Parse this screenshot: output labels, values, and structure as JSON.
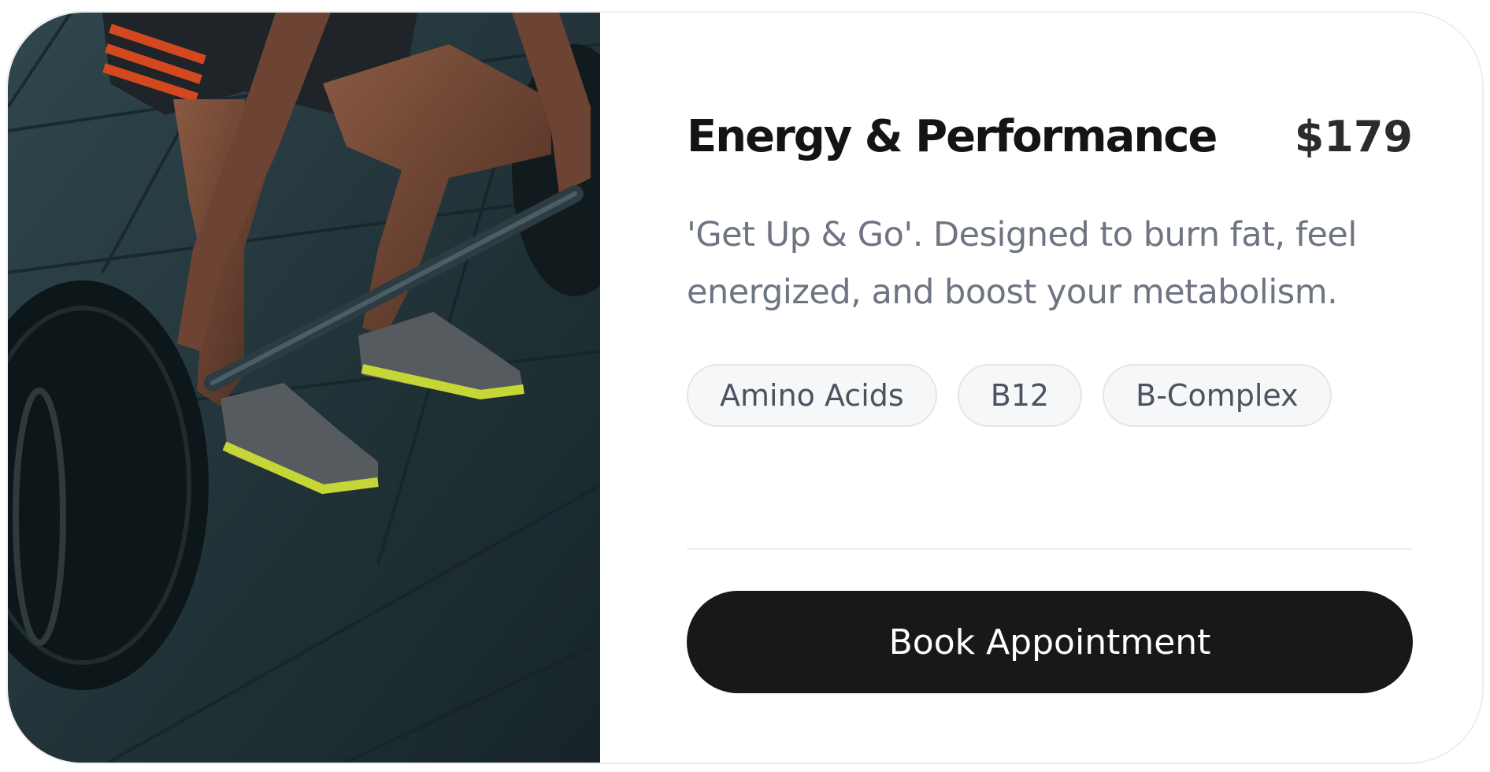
{
  "card": {
    "title": "Energy & Performance",
    "price": "$179",
    "description": "'Get Up & Go'. Designed to burn fat, feel energized, and boost your metabolism.",
    "tags": [
      "Amino Acids",
      "B12",
      "B-Complex"
    ],
    "cta_label": "Book Appointment",
    "image": "weightlifter-deadlift-photo"
  },
  "colors": {
    "title": "#141414",
    "price": "#2b2b2e",
    "description": "#6e7482",
    "tag_bg": "#f6f7f8",
    "tag_border": "#e3e5e8",
    "tag_text": "#4d5260",
    "button_bg": "#181818",
    "button_text": "#ffffff",
    "floor": "#1f3136"
  }
}
